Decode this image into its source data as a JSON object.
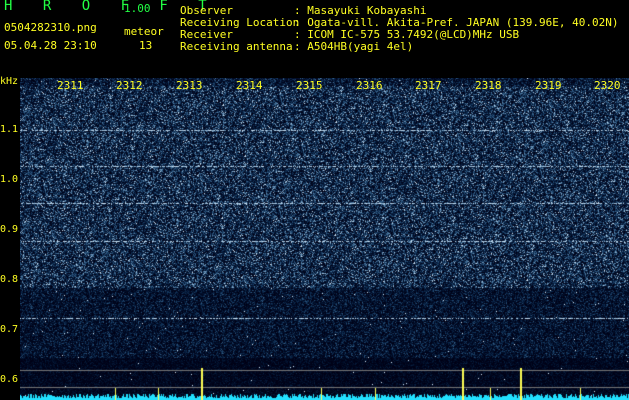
{
  "app": {
    "logo": "H R O F F T",
    "version": "1.00"
  },
  "file": {
    "name": "0504282310.png",
    "timestamp": "05.04.28 23:10"
  },
  "meteor": {
    "label": "meteor",
    "count": "13"
  },
  "station": [
    {
      "key": "Observer",
      "value": ": Masayuki Kobayashi"
    },
    {
      "key": "Receiving Location",
      "value": ": Ogata-vill. Akita-Pref. JAPAN (139.96E, 40.02N)"
    },
    {
      "key": "Receiver",
      "value": ": ICOM IC-575 53.7492(@LCD)MHz USB"
    },
    {
      "key": "Receiving antenna",
      "value": ": A504HB(yagi 4el)"
    }
  ],
  "axis": {
    "y_unit": "kHz",
    "y_ticks": [
      "1.1",
      "1.0",
      "0.9",
      "0.8",
      "0.7",
      "0.6"
    ],
    "x_ticks": [
      "2311",
      "2312",
      "2313",
      "2314",
      "2315",
      "2316",
      "2317",
      "2318",
      "2319",
      "2320"
    ]
  },
  "colors": {
    "label": "#ffff22",
    "title": "#22ff44",
    "background": "#000000",
    "spectrum": "#2a4cff",
    "level": "#22e0ff"
  }
}
